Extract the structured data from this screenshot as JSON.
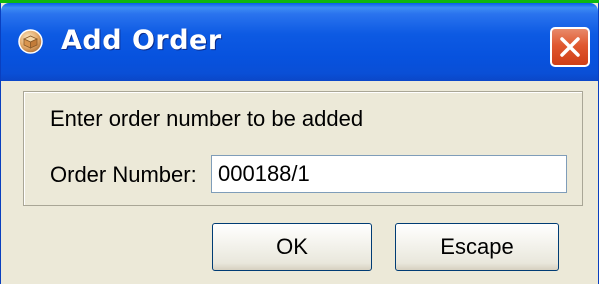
{
  "window": {
    "title": "Add Order",
    "icon": "package-icon"
  },
  "dialog": {
    "prompt": "Enter order number to be added",
    "order_number_label": "Order Number:",
    "order_number_value": "000188/1"
  },
  "buttons": {
    "ok_label": "OK",
    "escape_label": "Escape"
  },
  "colors": {
    "titlebar": "#0752de",
    "close_button": "#e0582f",
    "window_background": "#ece9d8",
    "screen_background": "#0fb80f"
  }
}
